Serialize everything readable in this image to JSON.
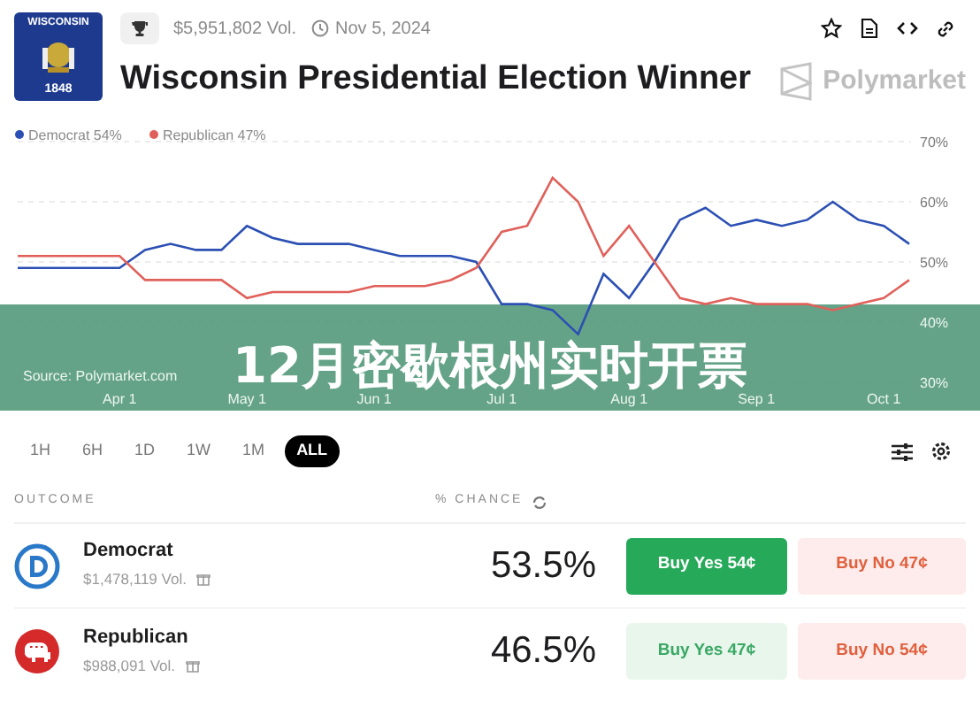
{
  "header": {
    "flag": {
      "label": "WISCONSIN",
      "year": "1848"
    },
    "volume": "$5,951,802 Vol.",
    "date": "Nov 5, 2024",
    "title": "Wisconsin Presidential Election Winner",
    "brand": "Polymarket"
  },
  "chart": {
    "source": "Source: Polymarket.com",
    "chart_data": {
      "type": "line",
      "categories": [
        null,
        null,
        null,
        null,
        "Apr 1",
        null,
        null,
        null,
        null,
        "May 1",
        null,
        null,
        null,
        null,
        "Jun 1",
        null,
        null,
        null,
        null,
        "Jul 1",
        null,
        null,
        null,
        null,
        "Aug 1",
        null,
        null,
        null,
        null,
        "Sep 1",
        null,
        null,
        null,
        null,
        "Oct 1",
        null
      ],
      "series": [
        {
          "name": "Democrat 54%",
          "color": "#2b4fb3",
          "values": [
            49,
            49,
            49,
            49,
            49,
            52,
            53,
            52,
            52,
            56,
            54,
            53,
            53,
            53,
            52,
            51,
            51,
            51,
            50,
            43,
            43,
            42,
            38,
            48,
            44,
            50,
            57,
            59,
            56,
            57,
            56,
            57,
            60,
            57,
            56,
            53
          ]
        },
        {
          "name": "Republican 47%",
          "color": "#e0605a",
          "values": [
            51,
            51,
            51,
            51,
            51,
            47,
            47,
            47,
            47,
            44,
            45,
            45,
            45,
            45,
            46,
            46,
            46,
            47,
            49,
            55,
            56,
            64,
            60,
            51,
            56,
            50,
            44,
            43,
            44,
            43,
            43,
            43,
            42,
            43,
            44,
            47
          ]
        }
      ],
      "legend": "top-left",
      "ylim": [
        30,
        70
      ],
      "yticks": [
        {
          "value": 70,
          "label": "70%"
        },
        {
          "value": 60,
          "label": "60%"
        },
        {
          "value": 50,
          "label": "50%"
        },
        {
          "value": 40,
          "label": "40%"
        },
        {
          "value": 30,
          "label": "30%"
        }
      ]
    }
  },
  "banner": "12月密歇根州实时开票",
  "time_ranges": [
    {
      "label": "1H",
      "selected": false
    },
    {
      "label": "6H",
      "selected": false
    },
    {
      "label": "1D",
      "selected": false
    },
    {
      "label": "1W",
      "selected": false
    },
    {
      "label": "1M",
      "selected": false
    },
    {
      "label": "ALL",
      "selected": true
    }
  ],
  "table": {
    "columns": [
      "OUTCOME",
      "% CHANCE"
    ],
    "rows": [
      {
        "kind": "democrat",
        "name": "Democrat",
        "volume": "$1,478,119 Vol.",
        "chance": "53.5%",
        "buy_yes": {
          "label": "Buy Yes 54¢",
          "selected": true
        },
        "buy_no": {
          "label": "Buy No 47¢",
          "selected": false
        }
      },
      {
        "kind": "republican",
        "name": "Republican",
        "volume": "$988,091 Vol.",
        "chance": "46.5%",
        "buy_yes": {
          "label": "Buy Yes 47¢",
          "selected": false
        },
        "buy_no": {
          "label": "Buy No 54¢",
          "selected": false
        }
      }
    ]
  }
}
